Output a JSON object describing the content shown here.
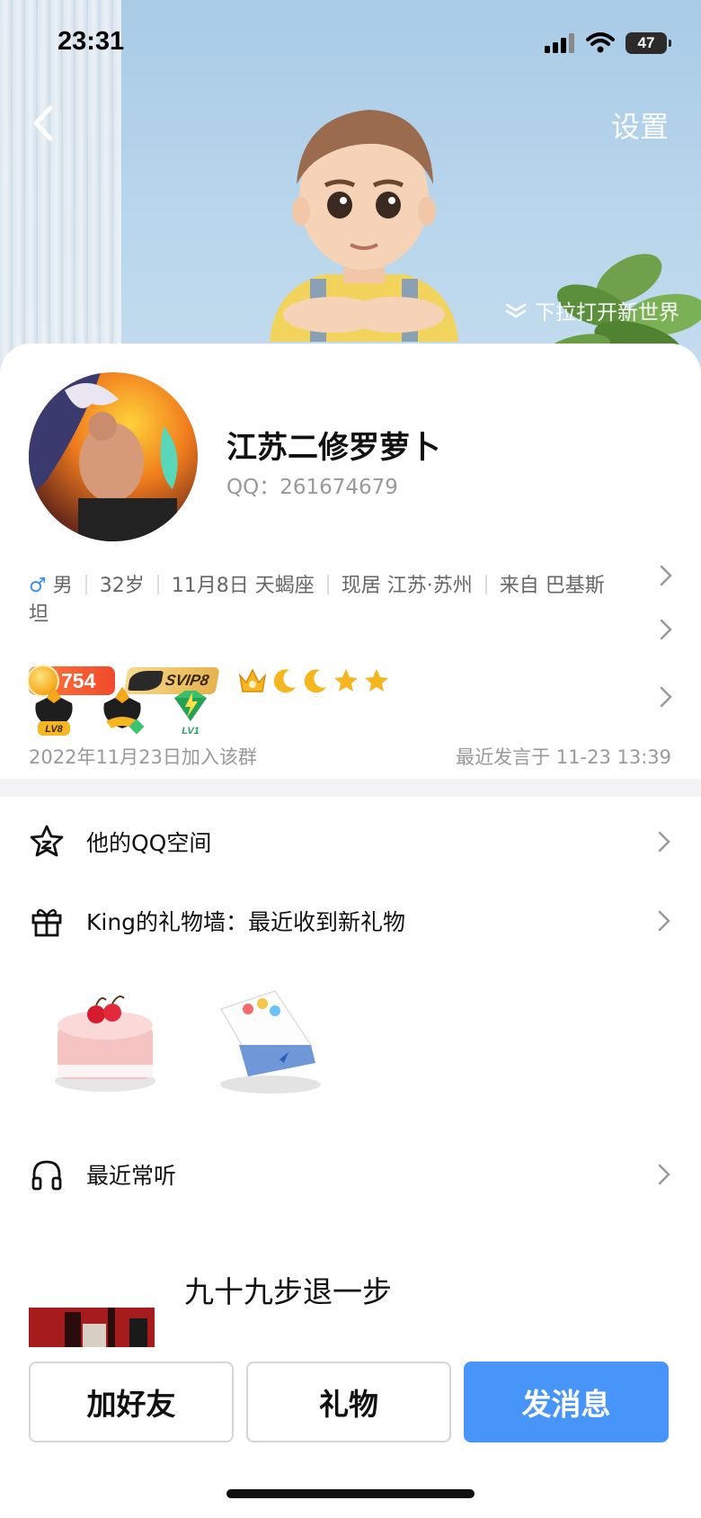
{
  "status_bar": {
    "time": "23:31",
    "battery": "47"
  },
  "header": {
    "settings_label": "设置",
    "pull_hint": "下拉打开新世界"
  },
  "profile": {
    "nickname": "江苏二修罗萝卜",
    "qq_number": "QQ：261674679",
    "gender_icon": "♂",
    "gender": "男",
    "age": "32岁",
    "birthday_sign": "11月8日 天蝎座",
    "location": "现居 江苏·苏州",
    "hometown_line1": "来自 巴基斯",
    "hometown_line2": "坦"
  },
  "badges": {
    "coins": "754",
    "svip": "SVIP8"
  },
  "medals": {
    "medal1_level": "LV8",
    "medal3_level": "LV1"
  },
  "group": {
    "join_date": "2022年11月23日加入该群",
    "last_speak": "最近发言于 11-23 13:39"
  },
  "menu": {
    "qzone_label": "他的QQ空间",
    "gift_wall_label": "King的礼物墙：最近收到新礼物",
    "recent_music_label": "最近常听",
    "song_title": "九十九步退一步"
  },
  "actions": {
    "add_friend": "加好友",
    "gift": "礼物",
    "message": "发消息"
  },
  "colors": {
    "primary": "#4795f8",
    "hero_bg": "#b9d6ec",
    "gender_blue": "#3b8fe6"
  },
  "icons": [
    "back-icon",
    "chevron-right-icon",
    "star-icon",
    "gift-icon",
    "headphones-icon",
    "signal-icon",
    "wifi-icon",
    "battery-icon"
  ]
}
